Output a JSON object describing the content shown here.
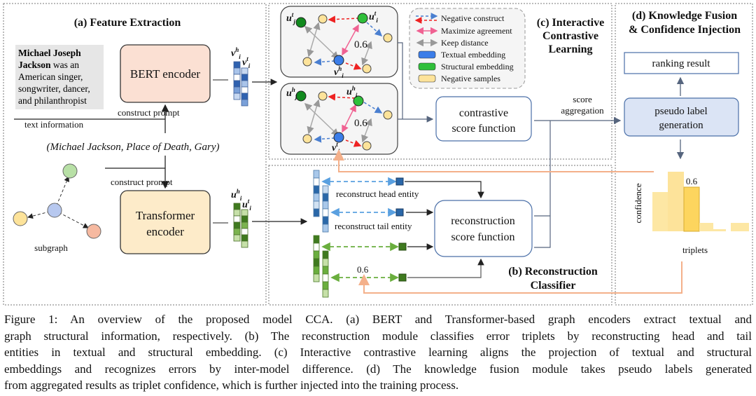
{
  "panel_a": {
    "title": "(a) Feature Extraction",
    "text_bold": "Michael Joseph Jackson",
    "text_rest": " was an American singer, songwriter, dancer, and philanthropist",
    "bert": "BERT encoder",
    "transformer": [
      "Transformer",
      "encoder"
    ],
    "construct_prompt": "construct prompt",
    "text_information": "text information",
    "triple": "(Michael Jackson, Place of Death, Gary)",
    "subgraph": "subgraph"
  },
  "panel_c": {
    "title": [
      "(c) Interactive",
      "Contrastive",
      "Learning"
    ],
    "value": "0.6",
    "score_fn": [
      "contrastive",
      "score function"
    ],
    "score_aggregation": [
      "score",
      "aggregation"
    ],
    "legend": [
      "Negative construct",
      "Maximize agreement",
      "Keep distance",
      "Textual embedding",
      "Structural embedding",
      "Negative samples"
    ]
  },
  "panel_b": {
    "title": [
      "(b) Reconstruction",
      "Classifier"
    ],
    "head": "reconstruct head entity",
    "tail": "reconstruct tail entity",
    "score_fn": [
      "reconstruction",
      "score function"
    ],
    "value": "0.6"
  },
  "panel_d": {
    "title": [
      "(d) Knowledge Fusion",
      "& Confidence Injection"
    ],
    "ranking": "ranking result",
    "pseudo": [
      "pseudo label",
      "generation"
    ],
    "ylabel": "confidence",
    "xlabel": "triplets",
    "bar_label": "0.6"
  },
  "colors": {
    "textual": "#3b7de8",
    "structural": "#2fbf3a",
    "negative": "#fde39a",
    "bert_box": "#fbe0d3",
    "transformer_box": "#fdebc9",
    "pseudo_box": "#dbe4f5",
    "feedback": "#f4b08a"
  },
  "caption": [
    "Figure 1: An overview of the proposed model CCA. (a) BERT and Transformer-based graph encoders extract textual and",
    "graph structural information, respectively. (b) The reconstruction module classifies error triplets by reconstructing head and tail",
    "entities in textual and structural embedding. (c) Interactive contrastive learning aligns the projection of textual and structural",
    "embeddings and recognizes errors by inter-model difference. (d) The knowledge fusion module takes pseudo labels generated",
    "from aggregated results as triplet confidence, which is further injected into the training process."
  ]
}
